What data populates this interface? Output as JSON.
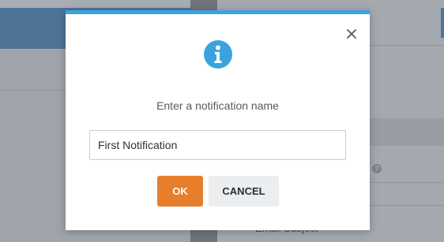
{
  "background": {
    "email_subject_label": "Email Subject",
    "help_icon": "help-circle-icon"
  },
  "modal": {
    "accent_color": "#3aa3dd",
    "info_icon": "info-icon",
    "close_icon": "close-icon",
    "prompt": "Enter a notification name",
    "input": {
      "value": "First Notification",
      "placeholder": ""
    },
    "ok_label": "OK",
    "ok_color": "#e67e2c",
    "cancel_label": "CANCEL"
  }
}
